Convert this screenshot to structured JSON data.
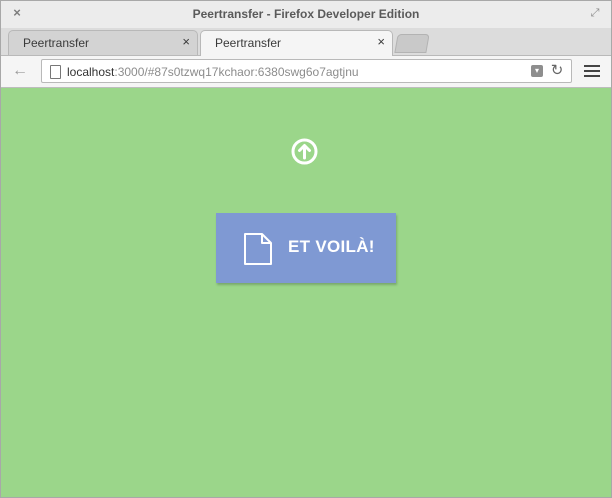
{
  "window": {
    "title": "Peertransfer - Firefox Developer Edition",
    "close_glyph": "×",
    "maximize_glyph": "⤢"
  },
  "tabs": [
    {
      "label": "Peertransfer",
      "close_glyph": "×",
      "active": false
    },
    {
      "label": "Peertransfer",
      "close_glyph": "×",
      "active": true
    }
  ],
  "navbar": {
    "back_glyph": "←",
    "url_host": "localhost",
    "url_rest": ":3000/#87s0tzwq17kchaor:6380swg6o7agtjnu",
    "dropdown_glyph": "▾",
    "reload_glyph": "↻"
  },
  "page": {
    "background": "#9bd68a",
    "upload_icon": "arrow-up-circle",
    "card_color": "#7f99d3",
    "file_icon": "document",
    "file_label": "ET VOILÀ!"
  }
}
